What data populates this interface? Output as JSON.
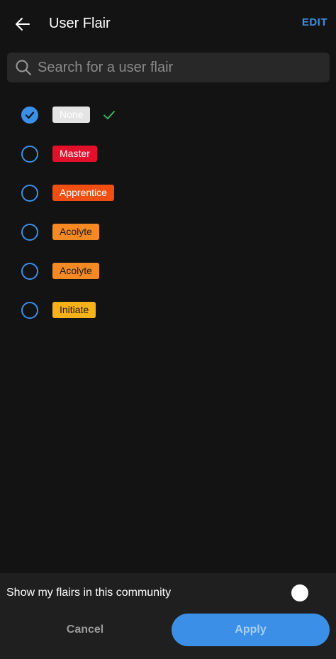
{
  "header": {
    "title": "User Flair",
    "edit_label": "EDIT",
    "back_icon": "arrow-left-icon"
  },
  "search": {
    "placeholder": "Search for a user flair",
    "value": "",
    "icon": "search-icon"
  },
  "flairs": [
    {
      "label": "None",
      "bg": "#e4e4e4",
      "fg": "#ffffff",
      "selected": true
    },
    {
      "label": "Master",
      "bg": "#e2102b",
      "fg": "#ffffff",
      "selected": false
    },
    {
      "label": "Apprentice",
      "bg": "#f04f11",
      "fg": "#ffffff",
      "selected": false
    },
    {
      "label": "Acolyte",
      "bg": "#f58a24",
      "fg": "#1a1a1a",
      "selected": false
    },
    {
      "label": "Acolyte",
      "bg": "#f58a24",
      "fg": "#1a1a1a",
      "selected": false
    },
    {
      "label": "Initiate",
      "bg": "#f7b21a",
      "fg": "#1a1a1a",
      "selected": false
    }
  ],
  "bottom": {
    "toggle_label": "Show my flairs in this community",
    "toggle_on": false,
    "cancel_label": "Cancel",
    "apply_label": "Apply"
  },
  "colors": {
    "accent": "#3b8fe6",
    "check_green": "#3fbf6b",
    "background": "#131313"
  }
}
